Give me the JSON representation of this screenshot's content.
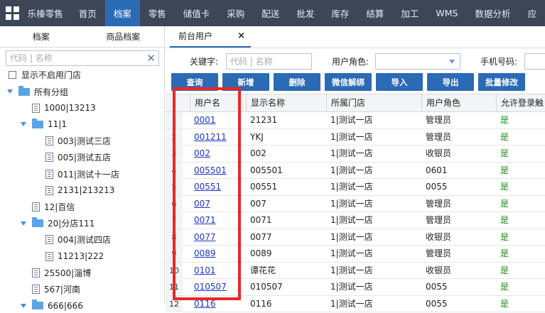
{
  "topnav": {
    "brand": "乐榛零售",
    "items": [
      "首页",
      "档案",
      "零售",
      "储值卡",
      "采购",
      "配送",
      "批发",
      "库存",
      "结算",
      "加工",
      "WMS",
      "数据分析",
      "应"
    ],
    "active_index": 1
  },
  "left": {
    "tabs": [
      "档案",
      "商品档案"
    ],
    "search_placeholder": "代码 | 名称",
    "show_disabled_label": "显示不启用门店",
    "tree": [
      {
        "label": "所有分组",
        "type": "folder",
        "level": 0,
        "expanded": true
      },
      {
        "label": "1000|13213",
        "type": "doc",
        "level": 1
      },
      {
        "label": "11|1",
        "type": "folder",
        "level": 1,
        "expanded": true
      },
      {
        "label": "003|测试三店",
        "type": "doc",
        "level": 2
      },
      {
        "label": "005|测试五店",
        "type": "doc",
        "level": 2
      },
      {
        "label": "011|测试十一店",
        "type": "doc",
        "level": 2
      },
      {
        "label": "2131|213213",
        "type": "doc",
        "level": 2
      },
      {
        "label": "12|百信",
        "type": "doc",
        "level": 1
      },
      {
        "label": "20|分店111",
        "type": "folder",
        "level": 1,
        "expanded": true
      },
      {
        "label": "004|测试四店",
        "type": "doc",
        "level": 2
      },
      {
        "label": "11213|222",
        "type": "doc",
        "level": 2
      },
      {
        "label": "25500|淄博",
        "type": "doc",
        "level": 1
      },
      {
        "label": "567|河南",
        "type": "doc",
        "level": 1
      },
      {
        "label": "666|666",
        "type": "folder",
        "level": 1,
        "expanded": true
      }
    ]
  },
  "content": {
    "tab_label": "前台用户",
    "tab_close": "×",
    "filter": {
      "keyword_label": "关键字:",
      "keyword_placeholder": "代码 | 名称",
      "role_label": "用户角色:",
      "phone_label": "手机号码:"
    },
    "buttons": [
      "查询",
      "新增",
      "删除",
      "微信解绑",
      "导入",
      "导出",
      "批量修改"
    ],
    "columns": [
      "用户名",
      "显示名称",
      "所属门店",
      "用户角色",
      "允许登录触"
    ],
    "rows": [
      {
        "num": "1",
        "username": "0001",
        "display": "21231",
        "store": "1|测试一店",
        "role": "管理员",
        "allow": "是"
      },
      {
        "num": "2",
        "username": "001211",
        "display": "YKJ",
        "store": "1|测试一店",
        "role": "管理员",
        "allow": "是"
      },
      {
        "num": "3",
        "username": "002",
        "display": "002",
        "store": "1|测试一店",
        "role": "收银员",
        "allow": "是"
      },
      {
        "num": "4",
        "username": "005501",
        "display": "005501",
        "store": "1|测试一店",
        "role": "0601",
        "allow": "是"
      },
      {
        "num": "5",
        "username": "00551",
        "display": "00551",
        "store": "1|测试一店",
        "role": "0055",
        "allow": "是"
      },
      {
        "num": "6",
        "username": "007",
        "display": "007",
        "store": "1|测试一店",
        "role": "管理员",
        "allow": "是"
      },
      {
        "num": "7",
        "username": "0071",
        "display": "0071",
        "store": "1|测试一店",
        "role": "管理员",
        "allow": "是"
      },
      {
        "num": "8",
        "username": "0077",
        "display": "0077",
        "store": "1|测试一店",
        "role": "收银员",
        "allow": "是"
      },
      {
        "num": "9",
        "username": "0089",
        "display": "0089",
        "store": "1|测试一店",
        "role": "管理员",
        "allow": "是"
      },
      {
        "num": "10",
        "username": "0101",
        "display": "谭花花",
        "store": "1|测试一店",
        "role": "收银员",
        "allow": "是"
      },
      {
        "num": "11",
        "username": "010507",
        "display": "010507",
        "store": "1|测试一店",
        "role": "0055",
        "allow": "是"
      },
      {
        "num": "12",
        "username": "0116",
        "display": "0116",
        "store": "1|测试一店",
        "role": "0055",
        "allow": "是"
      }
    ]
  },
  "colors": {
    "nav_bg": "#3c4657",
    "accent": "#2b6ab4",
    "highlight": "#e8282b",
    "link": "#1a35c8",
    "yes": "#1a8a1a"
  }
}
